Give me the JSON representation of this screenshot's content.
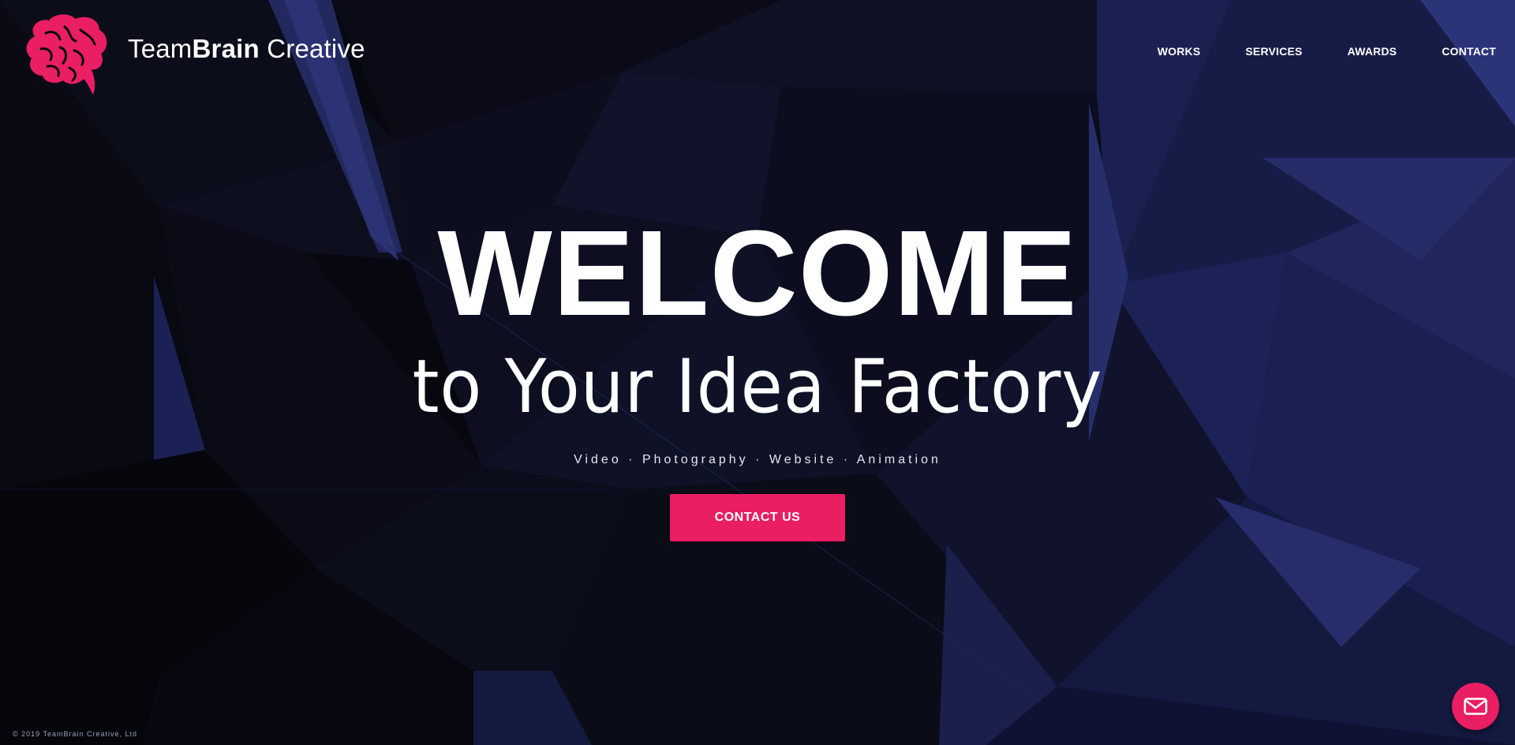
{
  "header": {
    "logo_text_light": "Team",
    "logo_text_bold": "Brain",
    "logo_text_suffix": " Creative",
    "logo_icon": "brain-icon"
  },
  "nav": {
    "items": [
      {
        "label": "WORKS"
      },
      {
        "label": "SERVICES"
      },
      {
        "label": "AWARDS"
      },
      {
        "label": "CONTACT"
      }
    ]
  },
  "hero": {
    "title": "WELCOME",
    "subtitle": "to Your Idea Factory",
    "tagline": "Video · Photography · Website · Animation",
    "cta_label": "CONTACT US"
  },
  "footer": {
    "copyright": "© 2019 TeamBrain Creative, Ltd"
  },
  "fab": {
    "icon": "mail-icon"
  },
  "colors": {
    "accent": "#e91e63",
    "background": "#07080f",
    "polygon_blue": "#2a3170",
    "text": "#ffffff"
  }
}
